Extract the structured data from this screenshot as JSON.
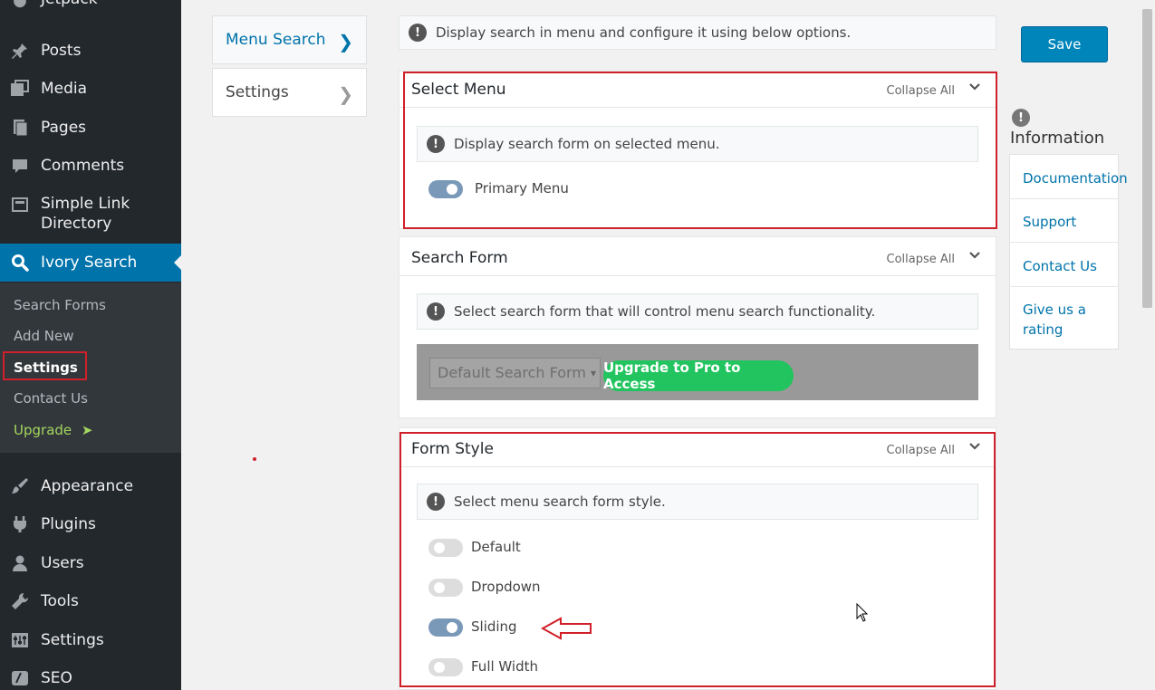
{
  "sidebar": {
    "top_partial": "Jetpack",
    "items": [
      {
        "label": "Posts",
        "icon": "pushpin-icon"
      },
      {
        "label": "Media",
        "icon": "media-icon"
      },
      {
        "label": "Pages",
        "icon": "pages-icon"
      },
      {
        "label": "Comments",
        "icon": "comment-icon"
      },
      {
        "label": "Simple Link Directory",
        "icon": "directory-icon"
      },
      {
        "label": "Ivory Search",
        "icon": "search-icon"
      },
      {
        "label": "Appearance",
        "icon": "brush-icon"
      },
      {
        "label": "Plugins",
        "icon": "plugin-icon"
      },
      {
        "label": "Users",
        "icon": "user-icon"
      },
      {
        "label": "Tools",
        "icon": "wrench-icon"
      },
      {
        "label": "Settings",
        "icon": "settings-icon"
      },
      {
        "label": "SEO",
        "icon": "seo-icon"
      }
    ],
    "submenu": [
      "Search Forms",
      "Add New",
      "Settings",
      "Contact Us",
      "Upgrade"
    ]
  },
  "tabs": {
    "menu_search": "Menu Search",
    "settings": "Settings"
  },
  "top_notice": "Display search in menu and configure it using below options.",
  "save_label": "Save",
  "panels": {
    "select_menu": {
      "title": "Select Menu",
      "collapse": "Collapse All",
      "notice": "Display search form on selected menu.",
      "options": [
        {
          "label": "Primary Menu",
          "on": true
        }
      ]
    },
    "search_form": {
      "title": "Search Form",
      "collapse": "Collapse All",
      "notice": "Select search form that will control menu search functionality.",
      "select_value": "Default Search Form",
      "upgrade_label": "Upgrade to Pro to Access"
    },
    "form_style": {
      "title": "Form Style",
      "collapse": "Collapse All",
      "notice": "Select menu search form style.",
      "options": [
        {
          "label": "Default",
          "on": false
        },
        {
          "label": "Dropdown",
          "on": false
        },
        {
          "label": "Sliding",
          "on": true
        },
        {
          "label": "Full Width",
          "on": false
        }
      ]
    }
  },
  "information": {
    "title": "Information",
    "links": [
      "Documentation",
      "Support",
      "Contact Us",
      "Give us a rating"
    ]
  },
  "colors": {
    "accent": "#0073aa",
    "highlight": "#d0202a",
    "upgrade_green": "#21c45e"
  }
}
